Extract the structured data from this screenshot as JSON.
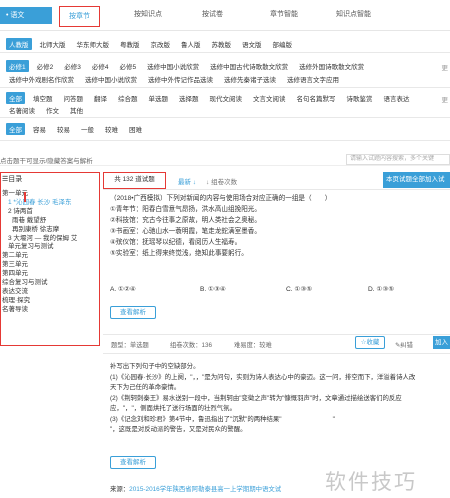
{
  "topnav": {
    "subject": "• 语文",
    "tabs": [
      "按章节",
      "按知识点",
      "按试卷",
      "章节智能",
      "知识点智能"
    ]
  },
  "filters": {
    "editions": [
      "人教版",
      "北师大版",
      "华东师大版",
      "粤教版",
      "京改版",
      "鲁人版",
      "苏教版",
      "语文版",
      "部编版"
    ],
    "books_row1": [
      "必修1",
      "必修2",
      "必修3",
      "必修4",
      "必修5",
      "选修中国小说欣赏",
      "选修中国古代诗歌散文欣赏",
      "选修外国诗歌散文欣赏"
    ],
    "books_row2": [
      "选修中外戏剧名作欣赏",
      "选修中国小说欣赏",
      "选修中外传记作品选读",
      "选修先秦诸子选读",
      "选修语言文字应用"
    ],
    "more": "更",
    "types_row1": [
      "全部",
      "填空题",
      "问答题",
      "翻译",
      "综合题",
      "单选题",
      "选择题",
      "现代文阅读",
      "文言文阅读",
      "名句名篇默写",
      "诗歌鉴赏",
      "语言表达"
    ],
    "types_row2": [
      "名著阅读",
      "作文",
      "其他"
    ],
    "difficulty": [
      "全部",
      "容易",
      "较易",
      "一般",
      "较难",
      "困难"
    ]
  },
  "hint": {
    "text": "点击题干可显示/隐藏答案与解析",
    "search_placeholder": "请输入试题内容搜索，多个关键"
  },
  "sidebar": {
    "title": "目录",
    "items": [
      "第一单元",
      "1 *沁园春 长沙 毛泽东",
      "2 诗两首",
      "雨巷 戴望舒",
      "再别康桥 徐志摩",
      "3 大堰河 — 我的保姆 艾",
      "单元复习与测试",
      "第二单元",
      "第三单元",
      "第四单元",
      "综合复习与测试",
      "表达交流",
      "梳理·探究",
      "名著导读"
    ]
  },
  "main": {
    "count": "共 132 道试题",
    "sort_latest": "最新",
    "sort_count": "组卷次数",
    "add_all": "本页试题全部加入试",
    "question_lines": [
      "（2018•广西模拟）下列对新闻的内容与使用场合对应正确的一组是（　　）",
      "①青年节：阳春白雪意气昂扬，洪水高山组挽阳光。",
      "②科技馆：究古今往事之原故，明人类社会之奥秘。",
      "③书画室：心驰山水一蓑明霞，笔走龙蛇满室墨香。",
      "④殡仪馆：抚瑶琴以纪德，看阅历人生福寿。",
      "⑤实验室：纸上得来终觉浅，绝知此事要躬行。"
    ],
    "options": [
      "A. ①②④",
      "B. ①③④",
      "C. ①③⑤",
      "D. ①③⑤"
    ],
    "view_analysis": "查看解析",
    "meta_type": "题型：单选题",
    "meta_count": "组卷次数：136",
    "meta_difficulty": "难易度：较难",
    "collect": "收藏",
    "error": "纠错",
    "add": "加入",
    "q2_lines": [
      "补写出下列句子中的空缺部分。",
      "(1)《沁园春·长沙》的上阕，\"，，\"是为问句，实则为诗人表达心中的豪迈。这一问，排空而下，洋溢着诗人改",
      "天下为己任的革命豪情。",
      "(2)《荆轲刺秦王》易水送别一段中，当荆轲由\"变徵之声\"转为\"慷慨羽声\"时，文章通过描绘送客们的反应",
      "应，\"，\"，侧面烘托了送行场面的壮烈气氛。",
      "(3)《记念刘和珍君》第4节中，鲁迅指出了\"沉默\"的两种结果\"　　　　　　　　\"",
      "\"，这既是对反动派的警告，又是对民众的警醒。"
    ],
    "source_label": "来源：",
    "source": "2015-2016学年陕西省阿勒泰县高一上学期期中语文试"
  },
  "watermark": "软件技巧",
  "colors": {
    "accent": "#3a9fd8",
    "highlight": "#e53935"
  }
}
